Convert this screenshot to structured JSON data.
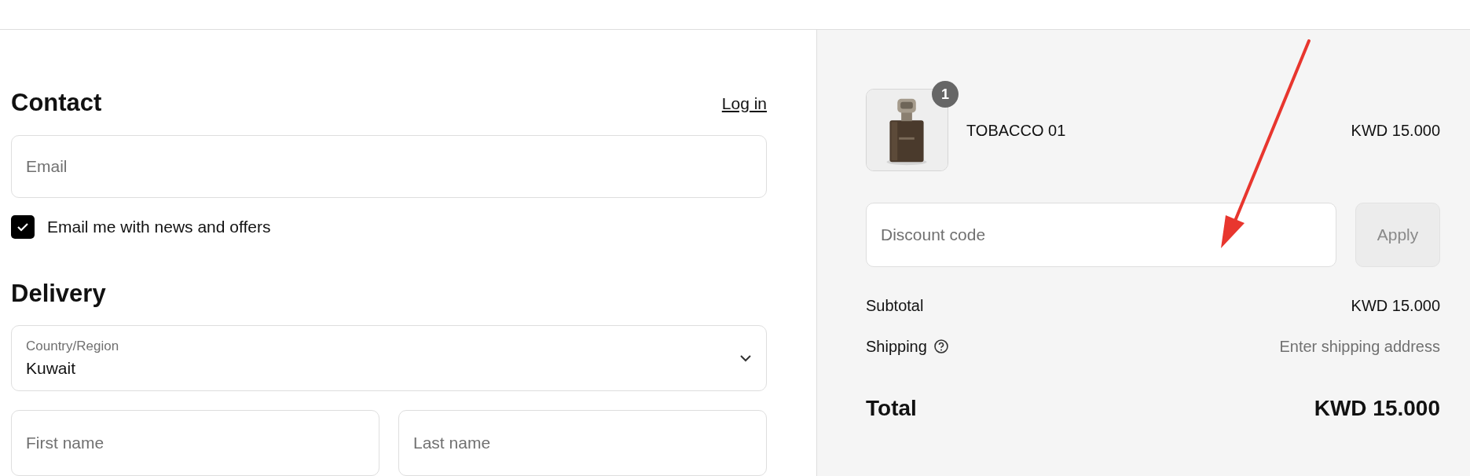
{
  "contact": {
    "heading": "Contact",
    "login_link": "Log in",
    "email": {
      "placeholder": "Email"
    },
    "newsletter": {
      "label": "Email me with news and offers",
      "checked": true
    }
  },
  "delivery": {
    "heading": "Delivery",
    "country": {
      "label": "Country/Region",
      "value": "Kuwait"
    },
    "first_name": {
      "placeholder": "First name"
    },
    "last_name": {
      "placeholder": "Last name"
    }
  },
  "summary": {
    "items": [
      {
        "kind": "picture",
        "quantity": "1",
        "name": "TOBACCO 01",
        "price": "KWD 15.000"
      }
    ],
    "discount": {
      "placeholder": "Discount code",
      "button": "Apply",
      "disabled": true
    },
    "subtotal": {
      "label": "Subtotal",
      "value": "KWD 15.000"
    },
    "shipping": {
      "label": "Shipping",
      "value": "Enter shipping address"
    },
    "total": {
      "label": "Total",
      "value": "KWD 15.000"
    }
  }
}
